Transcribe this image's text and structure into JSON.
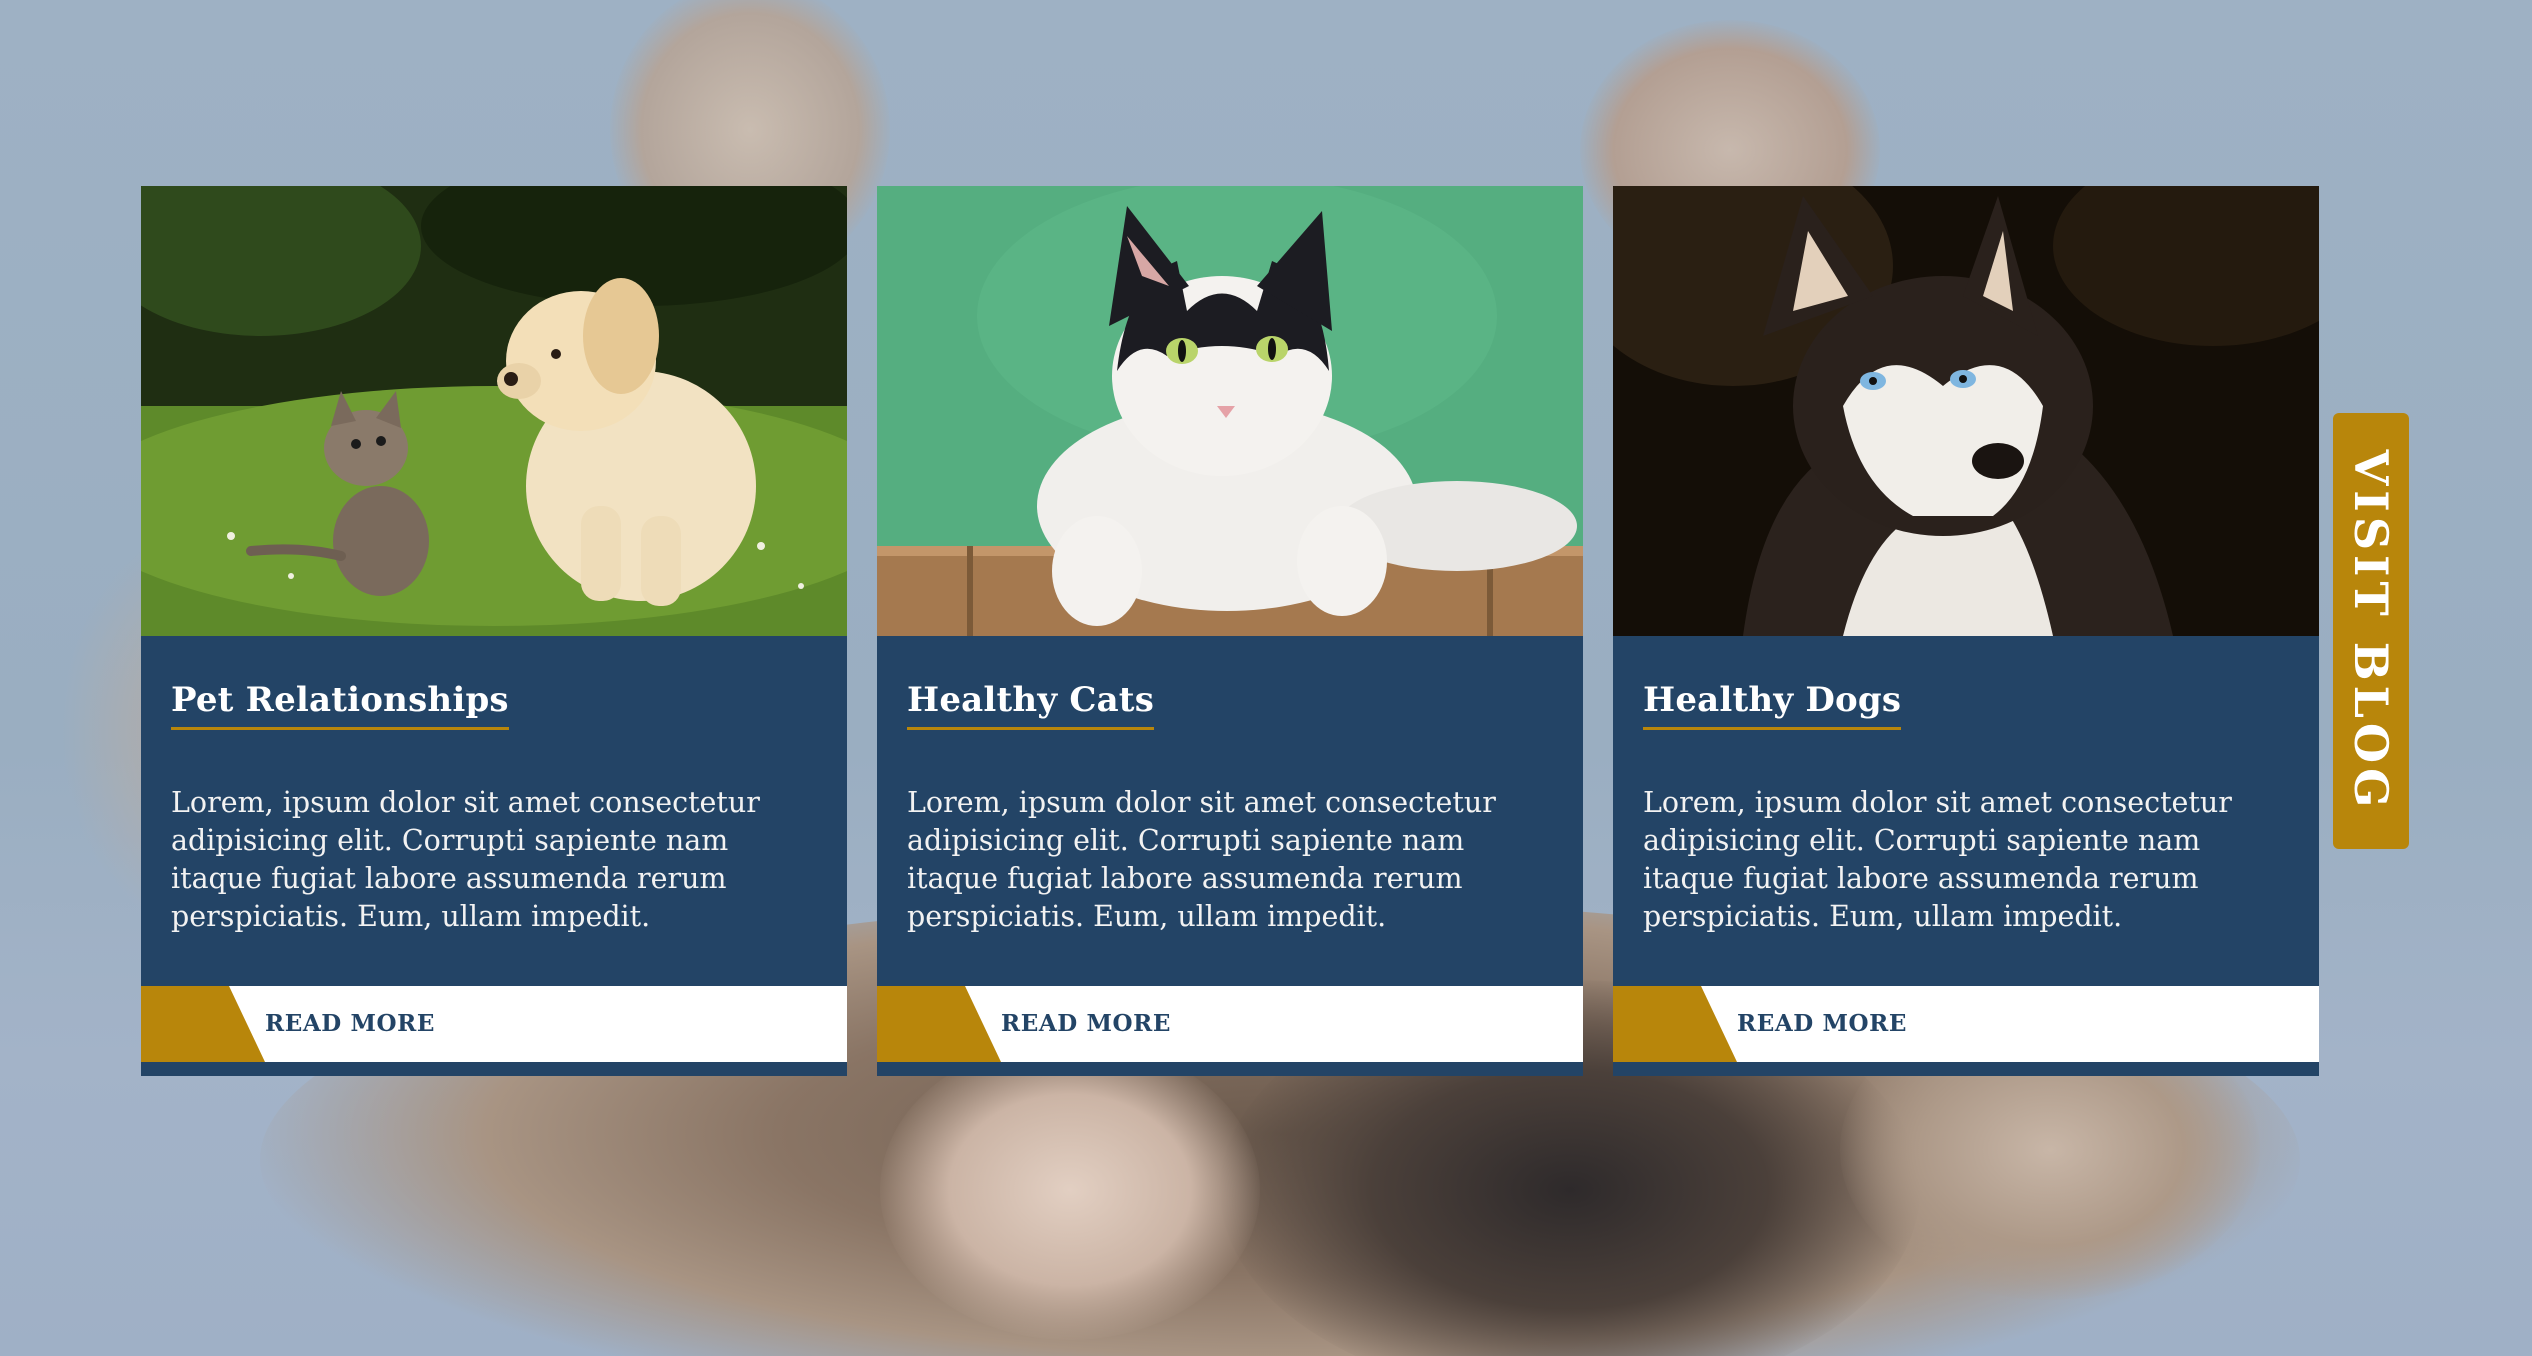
{
  "cards": [
    {
      "title": "Pet Relationships",
      "text": "Lorem, ipsum dolor sit amet consectetur adipisicing elit. Corrupti sapiente nam itaque fugiat labore assumenda rerum perspiciatis. Eum, ullam impedit.",
      "button_label": "READ MORE"
    },
    {
      "title": "Healthy Cats",
      "text": "Lorem, ipsum dolor sit amet consectetur adipisicing elit. Corrupti sapiente nam itaque fugiat labore assumenda rerum perspiciatis. Eum, ullam impedit.",
      "button_label": "READ MORE"
    },
    {
      "title": "Healthy Dogs",
      "text": "Lorem, ipsum dolor sit amet consectetur adipisicing elit. Corrupti sapiente nam itaque fugiat labore assumenda rerum perspiciatis. Eum, ullam impedit.",
      "button_label": "READ MORE"
    }
  ],
  "visit_blog_label": "VISIT BLOG",
  "colors": {
    "card_bg": "#234466",
    "accent": "#b8860b",
    "page_bg": "#9eb1c4",
    "button_bg": "#ffffff"
  }
}
